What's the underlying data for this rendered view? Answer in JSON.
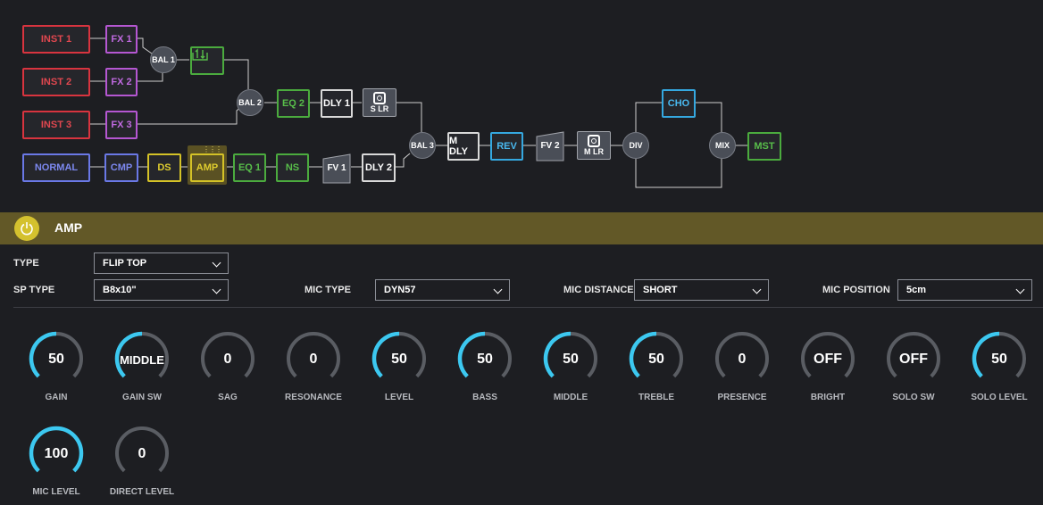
{
  "chain": {
    "blocks": {
      "inst1": "INST 1",
      "inst2": "INST 2",
      "inst3": "INST 3",
      "fx1": "FX 1",
      "fx2": "FX 2",
      "fx3": "FX 3",
      "bal1": "BAL 1",
      "bal2": "BAL 2",
      "bal3": "BAL 3",
      "eq2": "EQ 2",
      "dly1": "DLY 1",
      "slr": "S LR",
      "normal": "NORMAL",
      "cmp": "CMP",
      "ds": "DS",
      "amp": "AMP",
      "eq1": "EQ 1",
      "ns": "NS",
      "fv1": "FV 1",
      "dly2": "DLY 2",
      "mdly": "M DLY",
      "rev": "REV",
      "fv2": "FV 2",
      "mlr": "M LR",
      "div": "DIV",
      "cho": "CHO",
      "mix": "MIX",
      "mst": "MST"
    },
    "colors": {
      "inst": "#d8343f",
      "fx": "#b557d2",
      "green": "#4bab3e",
      "blue": "#6a78e6",
      "cyan": "#35a8e0",
      "yellow": "#d4c227"
    }
  },
  "panel": {
    "title": "AMP",
    "header_color": "#625827",
    "power_color": "#d4c12e"
  },
  "params": {
    "type_label": "TYPE",
    "type_value": "FLIP TOP",
    "sp_type_label": "SP TYPE",
    "sp_type_value": "B8x10\"",
    "mic_type_label": "MIC TYPE",
    "mic_type_value": "DYN57",
    "mic_distance_label": "MIC DISTANCE",
    "mic_distance_value": "SHORT",
    "mic_position_label": "MIC POSITION",
    "mic_position_value": "5cm"
  },
  "knobs": [
    {
      "label": "GAIN",
      "value": "50",
      "level": 0.5
    },
    {
      "label": "GAIN SW",
      "value": "MIDDLE",
      "level": 0.5
    },
    {
      "label": "SAG",
      "value": "0",
      "level": 0
    },
    {
      "label": "RESONANCE",
      "value": "0",
      "level": 0
    },
    {
      "label": "LEVEL",
      "value": "50",
      "level": 0.5
    },
    {
      "label": "BASS",
      "value": "50",
      "level": 0.5
    },
    {
      "label": "MIDDLE",
      "value": "50",
      "level": 0.5
    },
    {
      "label": "TREBLE",
      "value": "50",
      "level": 0.5
    },
    {
      "label": "PRESENCE",
      "value": "0",
      "level": 0
    },
    {
      "label": "BRIGHT",
      "value": "OFF",
      "level": 0
    },
    {
      "label": "SOLO SW",
      "value": "OFF",
      "level": 0
    },
    {
      "label": "SOLO LEVEL",
      "value": "50",
      "level": 0.5
    },
    {
      "label": "MIC LEVEL",
      "value": "100",
      "level": 1
    },
    {
      "label": "DIRECT LEVEL",
      "value": "0",
      "level": 0
    }
  ]
}
